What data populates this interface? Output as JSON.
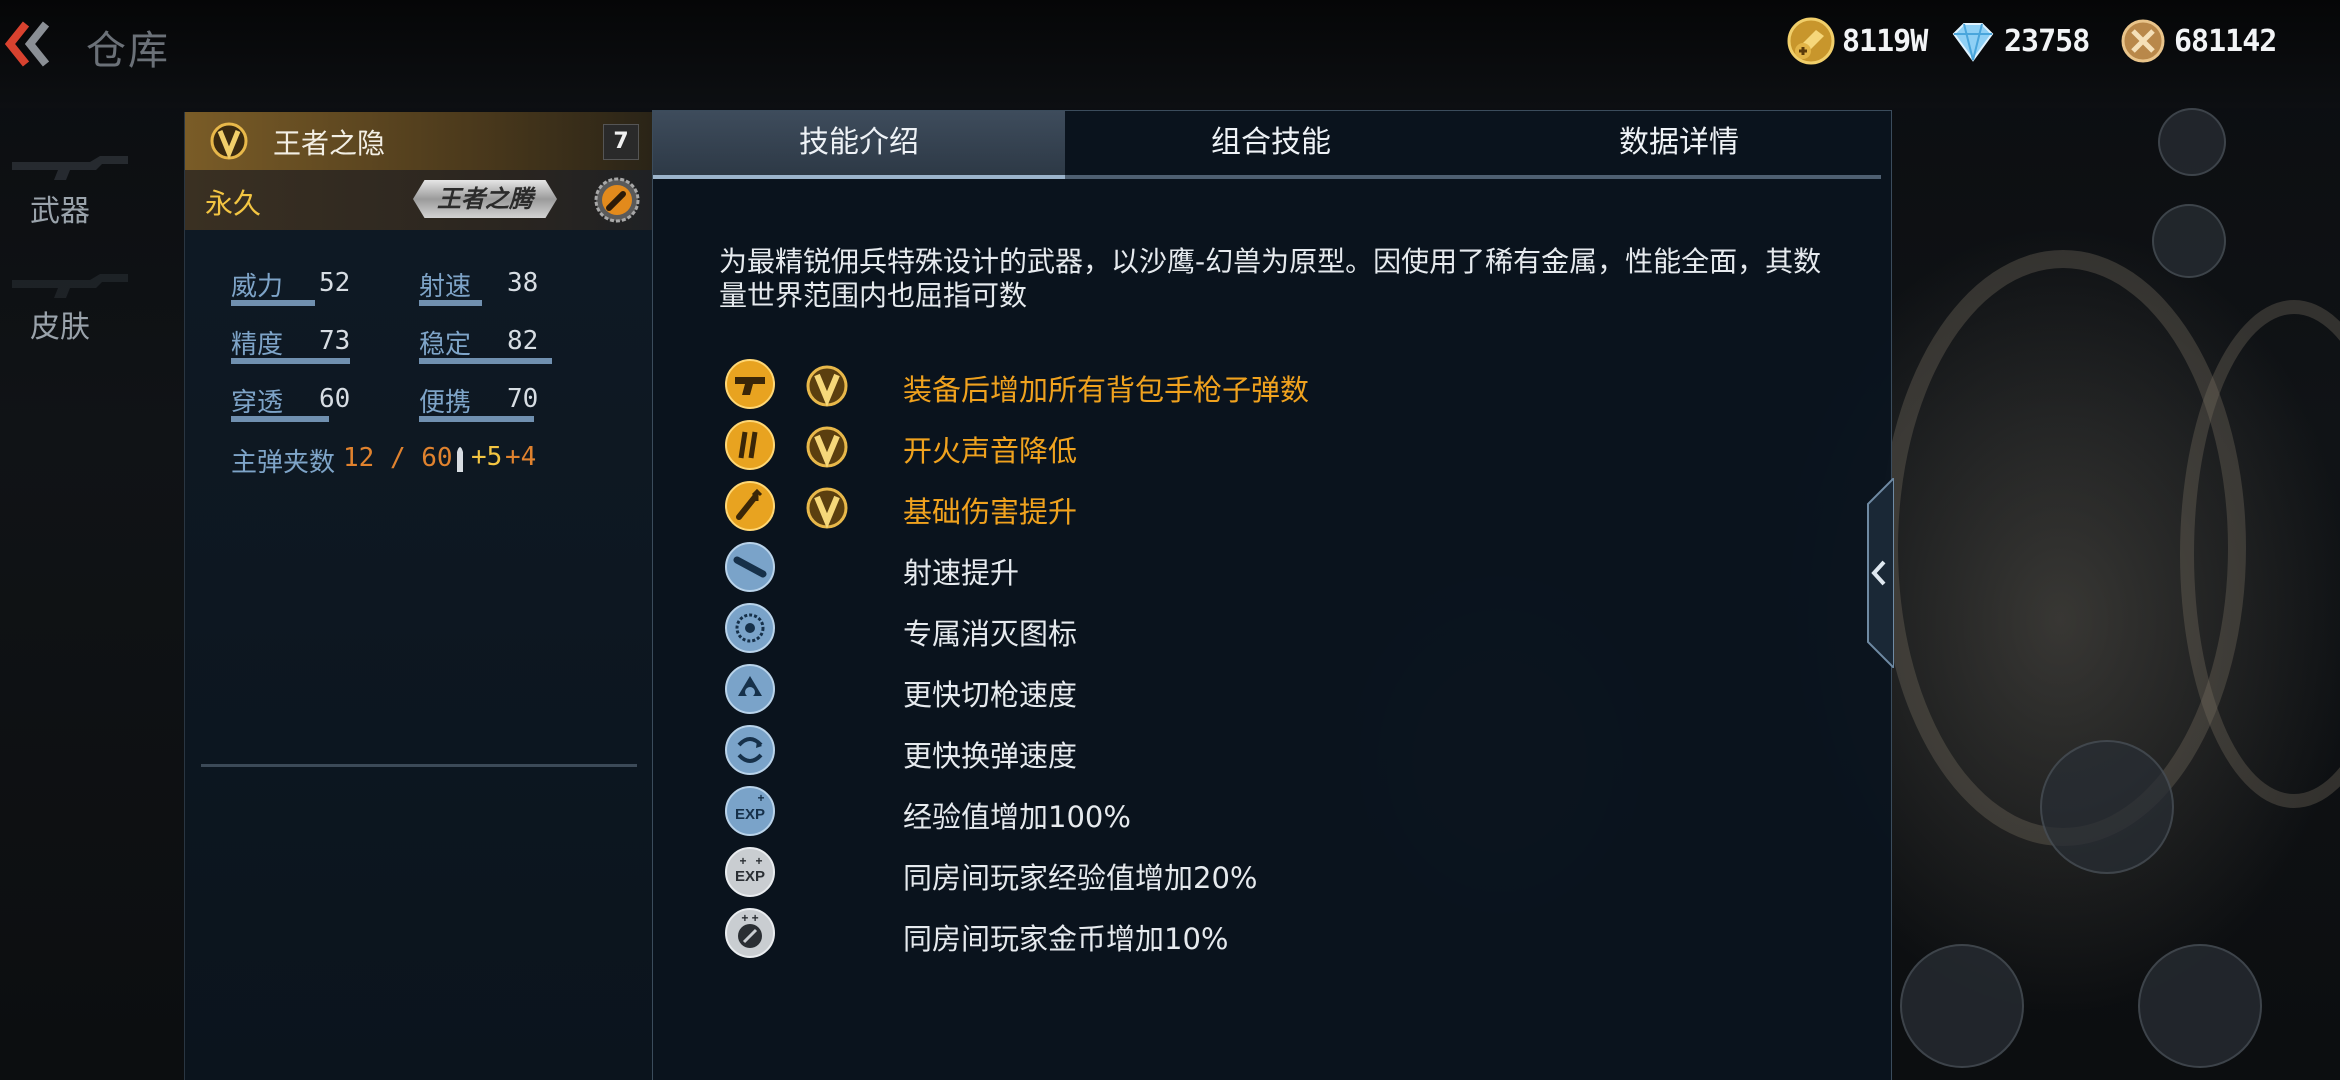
{
  "header": {
    "title": "仓库",
    "currencies": [
      {
        "icon": "gold-bar-icon",
        "value": "8119W"
      },
      {
        "icon": "diamond-icon",
        "value": "23758"
      },
      {
        "icon": "medal-coin-icon",
        "value": "681142"
      }
    ]
  },
  "sidebar": {
    "items": [
      {
        "label": "武器"
      },
      {
        "label": "皮肤"
      }
    ]
  },
  "weapon": {
    "name": "王者之隐",
    "level": "7",
    "duration": "永久",
    "title_plate": "王者之腾",
    "stats": [
      {
        "name": "威力",
        "value": "52",
        "level": 0.6
      },
      {
        "name": "射速",
        "value": "38",
        "level": 0.45
      },
      {
        "name": "精度",
        "value": "73",
        "level": 0.85
      },
      {
        "name": "稳定",
        "value": "82",
        "level": 0.95
      },
      {
        "name": "穿透",
        "value": "60",
        "level": 0.7
      },
      {
        "name": "便携",
        "value": "70",
        "level": 0.82
      }
    ],
    "ammo_label": "主弹夹数",
    "ammo_value": "12 / 60",
    "ammo_bonus_a": "+5",
    "ammo_bonus_b": "+4"
  },
  "tabs": [
    {
      "label": "技能介绍",
      "active": true
    },
    {
      "label": "组合技能",
      "active": false
    },
    {
      "label": "数据详情",
      "active": false
    }
  ],
  "description": "为最精锐佣兵特殊设计的武器，以沙鹰-幻兽为原型。因使用了稀有金属，性能全面，其数量世界范围内也屈指可数",
  "skills": [
    {
      "icon": "pistol-icon",
      "text": "装备后增加所有背包手枪子弹数",
      "vip": true
    },
    {
      "icon": "silencer-icon",
      "text": "开火声音降低",
      "vip": true
    },
    {
      "icon": "damage-up-icon",
      "text": "基础伤害提升",
      "vip": true
    },
    {
      "icon": "fire-rate-icon",
      "text": "射速提升",
      "vip": false
    },
    {
      "icon": "kill-icon",
      "text": "专属消灭图标",
      "vip": false
    },
    {
      "icon": "switch-speed-icon",
      "text": "更快切枪速度",
      "vip": false
    },
    {
      "icon": "reload-speed-icon",
      "text": "更快换弹速度",
      "vip": false
    },
    {
      "icon": "exp-icon",
      "text": "经验值增加100%",
      "vip": false
    },
    {
      "icon": "room-exp-icon",
      "text": "同房间玩家经验值增加20%",
      "vip": false
    },
    {
      "icon": "room-coin-icon",
      "text": "同房间玩家金币增加10%",
      "vip": false
    }
  ],
  "colors": {
    "gold": "#f0a21e",
    "stat_label": "#7ea4c8",
    "icon_blue": "#7aa3c9",
    "icon_gold": "#e8a320"
  }
}
